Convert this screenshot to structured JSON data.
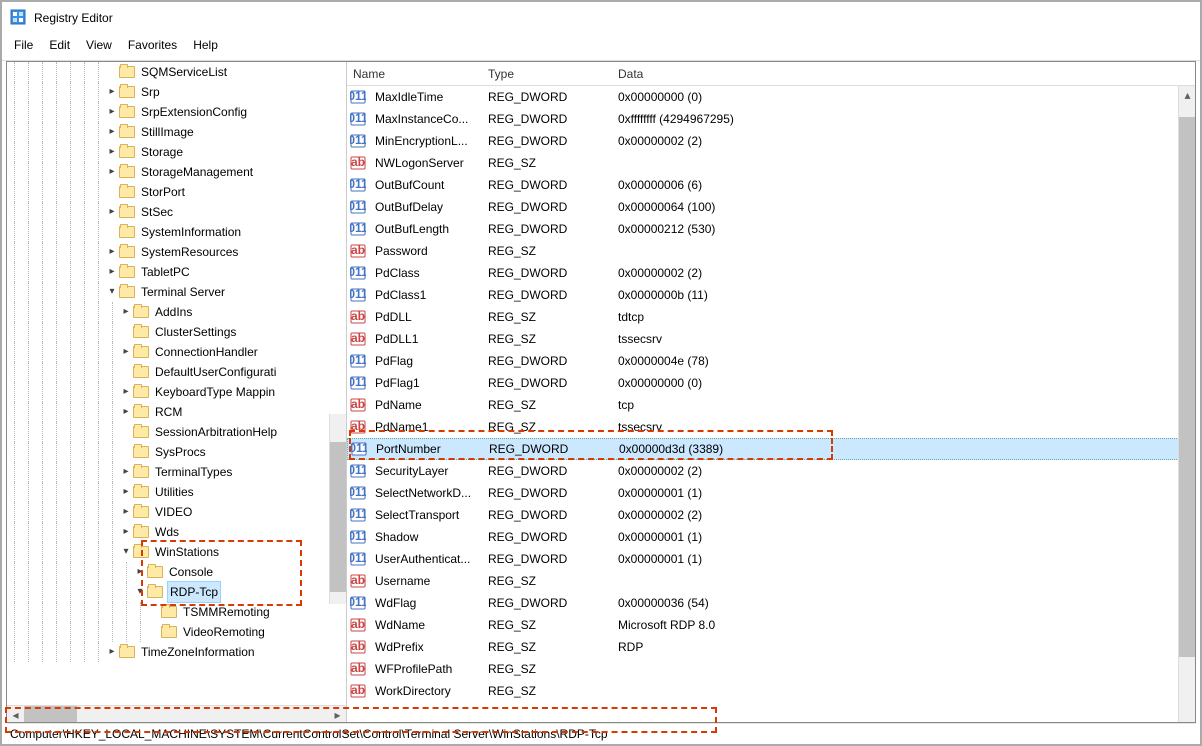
{
  "title": "Registry Editor",
  "menu": [
    "File",
    "Edit",
    "View",
    "Favorites",
    "Help"
  ],
  "tree": [
    {
      "indent": 7,
      "label": "SQMServiceList",
      "twist": ""
    },
    {
      "indent": 7,
      "label": "Srp",
      "twist": ">"
    },
    {
      "indent": 7,
      "label": "SrpExtensionConfig",
      "twist": ">"
    },
    {
      "indent": 7,
      "label": "StillImage",
      "twist": ">"
    },
    {
      "indent": 7,
      "label": "Storage",
      "twist": ">"
    },
    {
      "indent": 7,
      "label": "StorageManagement",
      "twist": ">"
    },
    {
      "indent": 7,
      "label": "StorPort",
      "twist": ""
    },
    {
      "indent": 7,
      "label": "StSec",
      "twist": ">"
    },
    {
      "indent": 7,
      "label": "SystemInformation",
      "twist": ""
    },
    {
      "indent": 7,
      "label": "SystemResources",
      "twist": ">"
    },
    {
      "indent": 7,
      "label": "TabletPC",
      "twist": ">"
    },
    {
      "indent": 7,
      "label": "Terminal Server",
      "twist": "v"
    },
    {
      "indent": 8,
      "label": "AddIns",
      "twist": ">"
    },
    {
      "indent": 8,
      "label": "ClusterSettings",
      "twist": ""
    },
    {
      "indent": 8,
      "label": "ConnectionHandler",
      "twist": ">"
    },
    {
      "indent": 8,
      "label": "DefaultUserConfigurati",
      "twist": ""
    },
    {
      "indent": 8,
      "label": "KeyboardType Mappin",
      "twist": ">"
    },
    {
      "indent": 8,
      "label": "RCM",
      "twist": ">"
    },
    {
      "indent": 8,
      "label": "SessionArbitrationHelp",
      "twist": ""
    },
    {
      "indent": 8,
      "label": "SysProcs",
      "twist": ""
    },
    {
      "indent": 8,
      "label": "TerminalTypes",
      "twist": ">"
    },
    {
      "indent": 8,
      "label": "Utilities",
      "twist": ">"
    },
    {
      "indent": 8,
      "label": "VIDEO",
      "twist": ">"
    },
    {
      "indent": 8,
      "label": "Wds",
      "twist": ">"
    },
    {
      "indent": 8,
      "label": "WinStations",
      "twist": "v"
    },
    {
      "indent": 9,
      "label": "Console",
      "twist": ">"
    },
    {
      "indent": 9,
      "label": "RDP-Tcp",
      "twist": "v",
      "selected": true
    },
    {
      "indent": 10,
      "label": "TSMMRemoting",
      "twist": ""
    },
    {
      "indent": 10,
      "label": "VideoRemoting",
      "twist": ""
    },
    {
      "indent": 7,
      "label": "TimeZoneInformation",
      "twist": ">"
    }
  ],
  "columns": {
    "name": "Name",
    "type": "Type",
    "data": "Data"
  },
  "rows": [
    {
      "icon": "dw",
      "name": "MaxIdleTime",
      "type": "REG_DWORD",
      "data": "0x00000000 (0)"
    },
    {
      "icon": "dw",
      "name": "MaxInstanceCo...",
      "type": "REG_DWORD",
      "data": "0xffffffff (4294967295)"
    },
    {
      "icon": "dw",
      "name": "MinEncryptionL...",
      "type": "REG_DWORD",
      "data": "0x00000002 (2)"
    },
    {
      "icon": "sz",
      "name": "NWLogonServer",
      "type": "REG_SZ",
      "data": ""
    },
    {
      "icon": "dw",
      "name": "OutBufCount",
      "type": "REG_DWORD",
      "data": "0x00000006 (6)"
    },
    {
      "icon": "dw",
      "name": "OutBufDelay",
      "type": "REG_DWORD",
      "data": "0x00000064 (100)"
    },
    {
      "icon": "dw",
      "name": "OutBufLength",
      "type": "REG_DWORD",
      "data": "0x00000212 (530)"
    },
    {
      "icon": "sz",
      "name": "Password",
      "type": "REG_SZ",
      "data": ""
    },
    {
      "icon": "dw",
      "name": "PdClass",
      "type": "REG_DWORD",
      "data": "0x00000002 (2)"
    },
    {
      "icon": "dw",
      "name": "PdClass1",
      "type": "REG_DWORD",
      "data": "0x0000000b (11)"
    },
    {
      "icon": "sz",
      "name": "PdDLL",
      "type": "REG_SZ",
      "data": "tdtcp"
    },
    {
      "icon": "sz",
      "name": "PdDLL1",
      "type": "REG_SZ",
      "data": "tssecsrv"
    },
    {
      "icon": "dw",
      "name": "PdFlag",
      "type": "REG_DWORD",
      "data": "0x0000004e (78)"
    },
    {
      "icon": "dw",
      "name": "PdFlag1",
      "type": "REG_DWORD",
      "data": "0x00000000 (0)"
    },
    {
      "icon": "sz",
      "name": "PdName",
      "type": "REG_SZ",
      "data": "tcp"
    },
    {
      "icon": "sz",
      "name": "PdName1",
      "type": "REG_SZ",
      "data": "tssecsrv"
    },
    {
      "icon": "dw",
      "name": "PortNumber",
      "type": "REG_DWORD",
      "data": "0x00000d3d (3389)",
      "selected": true
    },
    {
      "icon": "dw",
      "name": "SecurityLayer",
      "type": "REG_DWORD",
      "data": "0x00000002 (2)"
    },
    {
      "icon": "dw",
      "name": "SelectNetworkD...",
      "type": "REG_DWORD",
      "data": "0x00000001 (1)"
    },
    {
      "icon": "dw",
      "name": "SelectTransport",
      "type": "REG_DWORD",
      "data": "0x00000002 (2)"
    },
    {
      "icon": "dw",
      "name": "Shadow",
      "type": "REG_DWORD",
      "data": "0x00000001 (1)"
    },
    {
      "icon": "dw",
      "name": "UserAuthenticat...",
      "type": "REG_DWORD",
      "data": "0x00000001 (1)"
    },
    {
      "icon": "sz",
      "name": "Username",
      "type": "REG_SZ",
      "data": ""
    },
    {
      "icon": "dw",
      "name": "WdFlag",
      "type": "REG_DWORD",
      "data": "0x00000036 (54)"
    },
    {
      "icon": "sz",
      "name": "WdName",
      "type": "REG_SZ",
      "data": "Microsoft RDP 8.0"
    },
    {
      "icon": "sz",
      "name": "WdPrefix",
      "type": "REG_SZ",
      "data": "RDP"
    },
    {
      "icon": "sz",
      "name": "WFProfilePath",
      "type": "REG_SZ",
      "data": ""
    },
    {
      "icon": "sz",
      "name": "WorkDirectory",
      "type": "REG_SZ",
      "data": ""
    }
  ],
  "statusbar": "Computer\\HKEY_LOCAL_MACHINE\\SYSTEM\\CurrentControlSet\\Control\\Terminal Server\\WinStations\\RDP-Tcp"
}
